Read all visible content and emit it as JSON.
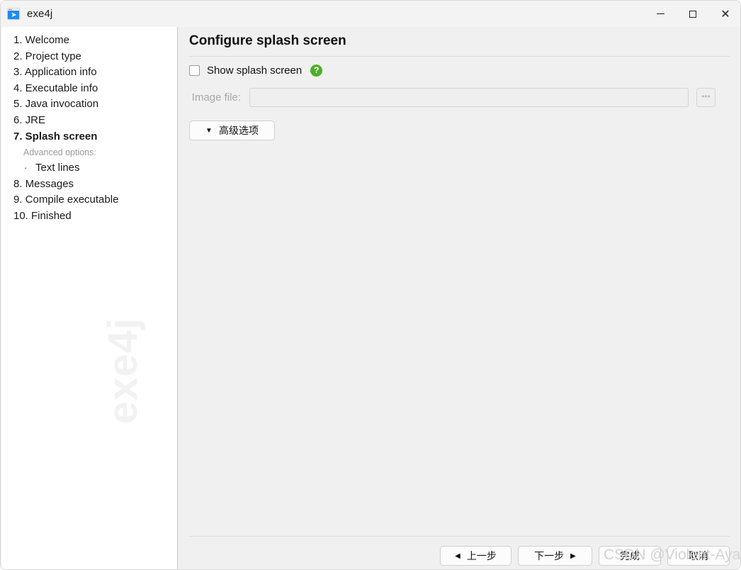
{
  "window": {
    "title": "exe4j",
    "icon": "rocket-icon",
    "controls": {
      "minimize": "—",
      "maximize": "□",
      "close": "×"
    }
  },
  "sidebar": {
    "watermark": "exe4j",
    "steps": [
      {
        "label": "1. Welcome",
        "current": false
      },
      {
        "label": "2. Project type",
        "current": false
      },
      {
        "label": "3. Application info",
        "current": false
      },
      {
        "label": "4. Executable info",
        "current": false
      },
      {
        "label": "5. Java invocation",
        "current": false
      },
      {
        "label": "6. JRE",
        "current": false
      },
      {
        "label": "7. Splash screen",
        "current": true
      }
    ],
    "advanced_header": "Advanced options:",
    "advanced_items": [
      {
        "bullet": "·",
        "label": "Text lines"
      }
    ],
    "steps_after": [
      {
        "label": "8. Messages",
        "current": false
      },
      {
        "label": "9. Compile executable",
        "current": false
      },
      {
        "label": "10. Finished",
        "current": false
      }
    ]
  },
  "main": {
    "page_title": "Configure splash screen",
    "show_splash": {
      "label": "Show splash screen",
      "checked": false,
      "help_glyph": "?"
    },
    "image_file": {
      "label": "Image file:",
      "value": "",
      "placeholder": "",
      "browse_label": "•••"
    },
    "advanced_options_button": {
      "caret": "▼",
      "label": "高级选项"
    }
  },
  "footer": {
    "prev": {
      "arrow": "◀",
      "label": "上一步"
    },
    "next": {
      "label": "下一步",
      "arrow": "▶"
    },
    "finish": {
      "label": "完成"
    },
    "cancel": {
      "label": "取消"
    }
  },
  "watermark": {
    "text": "CSDN @Violent-Ayang"
  },
  "colors": {
    "accent_green": "#4caf28",
    "icon_blue": "#1f8bf0",
    "sidebar_bg": "#ffffff",
    "panel_bg": "#f0f0f0"
  }
}
